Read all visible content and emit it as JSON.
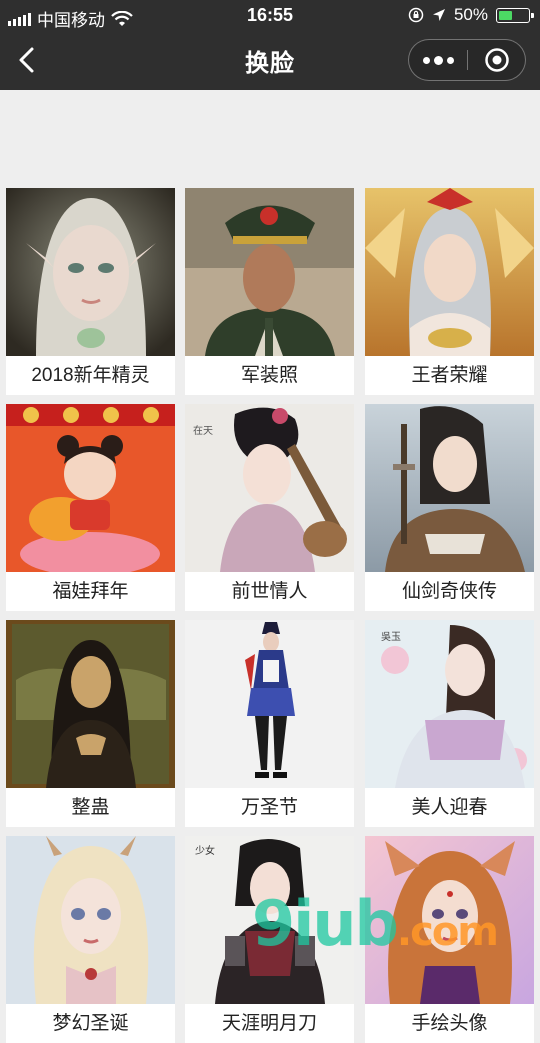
{
  "status_bar": {
    "carrier": "中国移动",
    "time": "16:55",
    "battery_percent": "50%",
    "battery_level": 0.5,
    "icons": [
      "signal-icon",
      "wifi-icon",
      "lock-rotation-icon",
      "location-icon",
      "battery-icon"
    ]
  },
  "nav": {
    "title": "换脸",
    "icons": [
      "back-arrow-icon",
      "more-dots-icon",
      "close-circle-icon"
    ]
  },
  "items": [
    {
      "label": "2018新年精灵"
    },
    {
      "label": "军装照"
    },
    {
      "label": "王者荣耀"
    },
    {
      "label": "福娃拜年"
    },
    {
      "label": "前世情人"
    },
    {
      "label": "仙剑奇侠传"
    },
    {
      "label": "整蛊"
    },
    {
      "label": "万圣节"
    },
    {
      "label": "美人迎春"
    },
    {
      "label": "梦幻圣诞"
    },
    {
      "label": "天涯明月刀"
    },
    {
      "label": "手绘头像"
    }
  ],
  "watermark": {
    "main": "9iub",
    "suffix": ".com"
  },
  "colors": {
    "bar_bg": "#2f2f2f",
    "page_bg": "#eeeeee",
    "battery_fill": "#4cd964"
  }
}
